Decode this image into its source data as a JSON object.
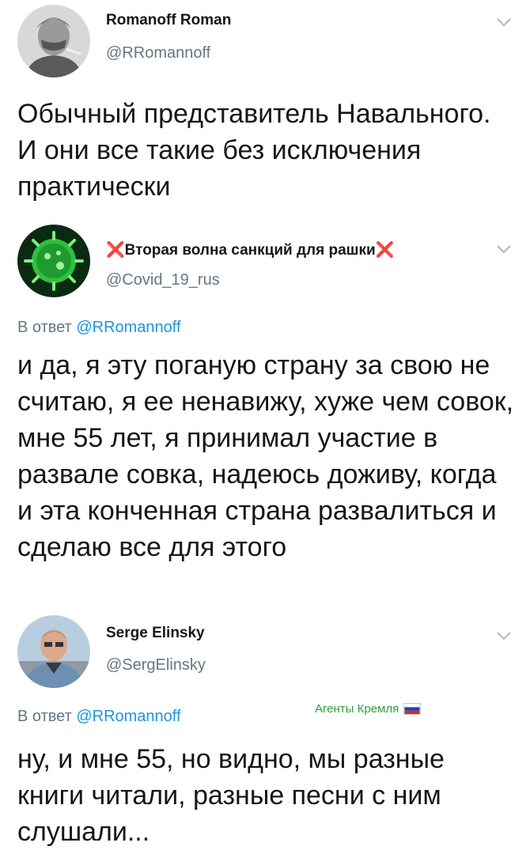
{
  "tweets": [
    {
      "name": "Romanoff Roman",
      "handle": "@RRomannoff",
      "text": "Обычный представитель Навального. И они все такие без исключения практически"
    },
    {
      "name_prefix": "❌",
      "name": "Вторая волна санкций для рашки",
      "name_suffix": "❌",
      "handle": "@Covid_19_rus",
      "reply_prefix": "В ответ ",
      "reply_to": "@RRomannoff",
      "text": "и да, я эту поганую страну за свою не считаю, я ее ненавижу, хуже чем совок, мне 55 лет, я принимал участие в развале совка, надеюсь доживу, когда и эта конченная страна развалиться и сделаю все для этого"
    },
    {
      "name": "Serge Elinsky",
      "handle": "@SergElinsky",
      "reply_prefix": "В ответ ",
      "reply_to": "@RRomannoff",
      "badge": "Агенты Кремля",
      "text": "ну, и мне 55, но видно, мы разные книги читали, разные песни с ним слушали..."
    }
  ],
  "icons": {
    "avatar_1": "avatar-man-smoking",
    "avatar_2": "virus-avatar",
    "avatar_3": "avatar-man-glasses",
    "chevron": "chevron-down-icon",
    "flag": "russian-flag-icon"
  },
  "colors": {
    "text": "#14171a",
    "secondary": "#657786",
    "link": "#1b95e0",
    "cross": "#e0245e",
    "badge": "#2f9e44"
  }
}
